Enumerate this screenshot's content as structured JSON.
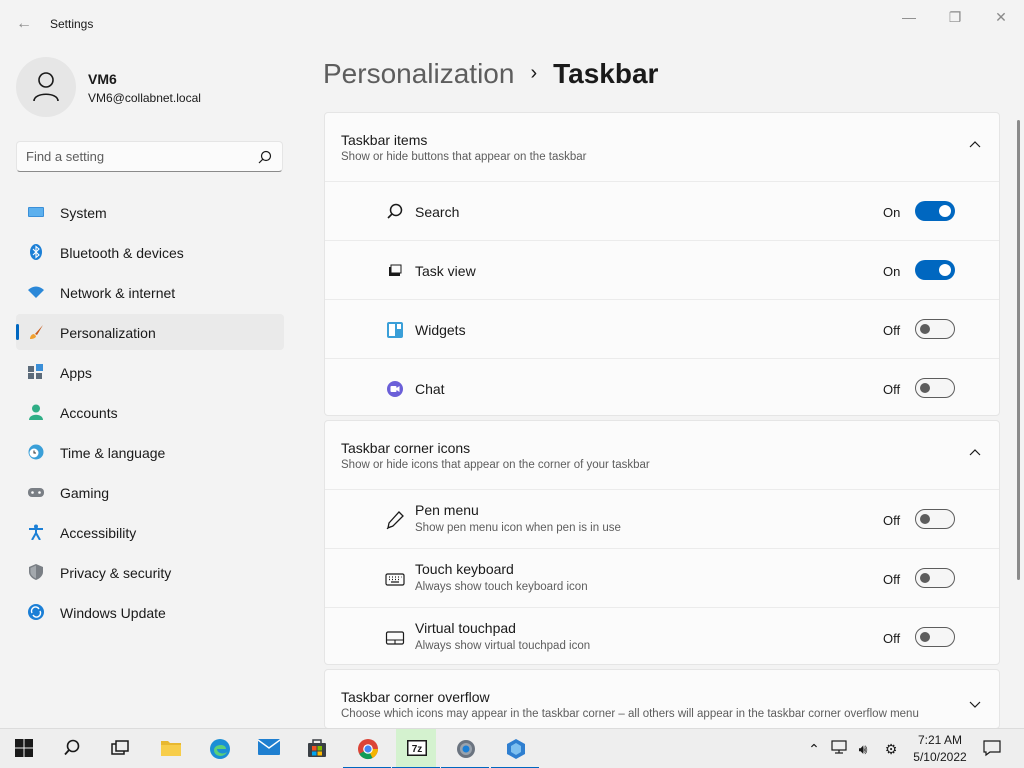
{
  "window": {
    "title": "Settings",
    "controls": {
      "minimize": "—",
      "maximize": "❐",
      "close": "✕"
    }
  },
  "user": {
    "name": "VM6",
    "email": "VM6@collabnet.local"
  },
  "search": {
    "placeholder": "Find a setting"
  },
  "nav": {
    "items": [
      {
        "label": "System",
        "icon": "system-icon"
      },
      {
        "label": "Bluetooth & devices",
        "icon": "bluetooth-icon"
      },
      {
        "label": "Network & internet",
        "icon": "wifi-icon"
      },
      {
        "label": "Personalization",
        "icon": "brush-icon",
        "active": true
      },
      {
        "label": "Apps",
        "icon": "apps-icon"
      },
      {
        "label": "Accounts",
        "icon": "accounts-icon"
      },
      {
        "label": "Time & language",
        "icon": "clock-globe-icon"
      },
      {
        "label": "Gaming",
        "icon": "gamepad-icon"
      },
      {
        "label": "Accessibility",
        "icon": "accessibility-icon"
      },
      {
        "label": "Privacy & security",
        "icon": "shield-icon"
      },
      {
        "label": "Windows Update",
        "icon": "update-icon"
      }
    ]
  },
  "breadcrumb": {
    "parent": "Personalization",
    "separator": "›",
    "current": "Taskbar"
  },
  "sections": {
    "items": {
      "title": "Taskbar items",
      "subtitle": "Show or hide buttons that appear on the taskbar",
      "rows": [
        {
          "label": "Search",
          "state": "On",
          "on": true,
          "icon": "search-icon"
        },
        {
          "label": "Task view",
          "state": "On",
          "on": true,
          "icon": "task-view-icon"
        },
        {
          "label": "Widgets",
          "state": "Off",
          "on": false,
          "icon": "widgets-icon"
        },
        {
          "label": "Chat",
          "state": "Off",
          "on": false,
          "icon": "chat-icon"
        }
      ]
    },
    "corner": {
      "title": "Taskbar corner icons",
      "subtitle": "Show or hide icons that appear on the corner of your taskbar",
      "rows": [
        {
          "label": "Pen menu",
          "sub": "Show pen menu icon when pen is in use",
          "state": "Off",
          "on": false,
          "icon": "pen-icon"
        },
        {
          "label": "Touch keyboard",
          "sub": "Always show touch keyboard icon",
          "state": "Off",
          "on": false,
          "icon": "keyboard-icon"
        },
        {
          "label": "Virtual touchpad",
          "sub": "Always show virtual touchpad icon",
          "state": "Off",
          "on": false,
          "icon": "touchpad-icon"
        }
      ]
    },
    "overflow": {
      "title": "Taskbar corner overflow",
      "subtitle": "Choose which icons may appear in the taskbar corner – all others will appear in the taskbar corner overflow menu"
    }
  },
  "taskbar": {
    "apps": [
      "start-icon",
      "search-icon",
      "task-view-icon",
      "file-explorer-icon",
      "edge-icon",
      "mail-icon",
      "store-icon",
      "chrome-icon",
      "7zip-icon",
      "settings-icon",
      "app-icon"
    ],
    "clock": {
      "time": "7:21 AM",
      "date": "5/10/2022"
    }
  },
  "colors": {
    "accent": "#0067c0",
    "background": "#f3f3f3",
    "card": "#fbfbfb"
  }
}
